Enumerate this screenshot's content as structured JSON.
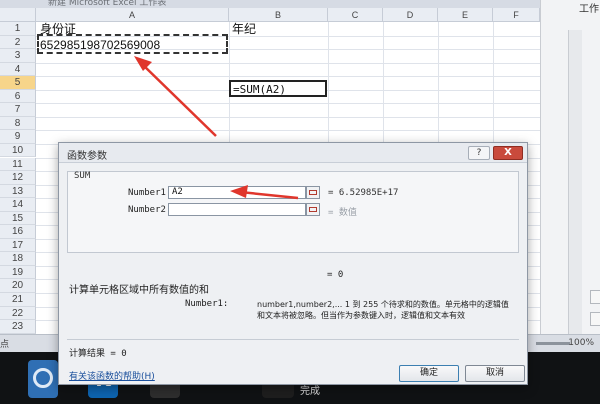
{
  "excel": {
    "title": "新建 Microsoft Excel 工作表",
    "right_pane_label": "工作",
    "columns": [
      "A",
      "B",
      "C",
      "D",
      "E",
      "F"
    ],
    "rows": [
      "1",
      "2",
      "3",
      "4",
      "5",
      "6",
      "7",
      "8",
      "9",
      "10",
      "11",
      "12",
      "13",
      "14",
      "15",
      "16",
      "17",
      "18",
      "19",
      "20",
      "21",
      "22",
      "23"
    ],
    "active_row": "5",
    "cells": {
      "a1": "身份证",
      "b1": "年纪",
      "a2": "652985198702569008",
      "b5": "=SUM(A2)"
    },
    "status_left": "点",
    "zoom": "100%"
  },
  "dialog": {
    "title": "函数参数",
    "help": "?",
    "close": "X",
    "function_name": "SUM",
    "args": [
      {
        "label": "Number1",
        "value": "A2",
        "result": "= 6.52985E+17"
      },
      {
        "label": "Number2",
        "value": "",
        "result": "= 数值"
      }
    ],
    "total_result": "= 0",
    "description": "计算单元格区域中所有数值的和",
    "param_name": "Number1:",
    "param_desc_1": "number1,number2,... 1 到 255 个待求和的数值。单元格中的逻辑值",
    "param_desc_2": "和文本将被忽略。但当作为参数键入时，逻辑值和文本有效",
    "calc_result_label": "计算结果 = 0",
    "help_link": "有关该函数的帮助(H)",
    "ok": "确定",
    "cancel": "取消"
  },
  "taskbar": {
    "app2_letter": "K",
    "active_label": "完成"
  },
  "annotation_color": "#e0362c"
}
